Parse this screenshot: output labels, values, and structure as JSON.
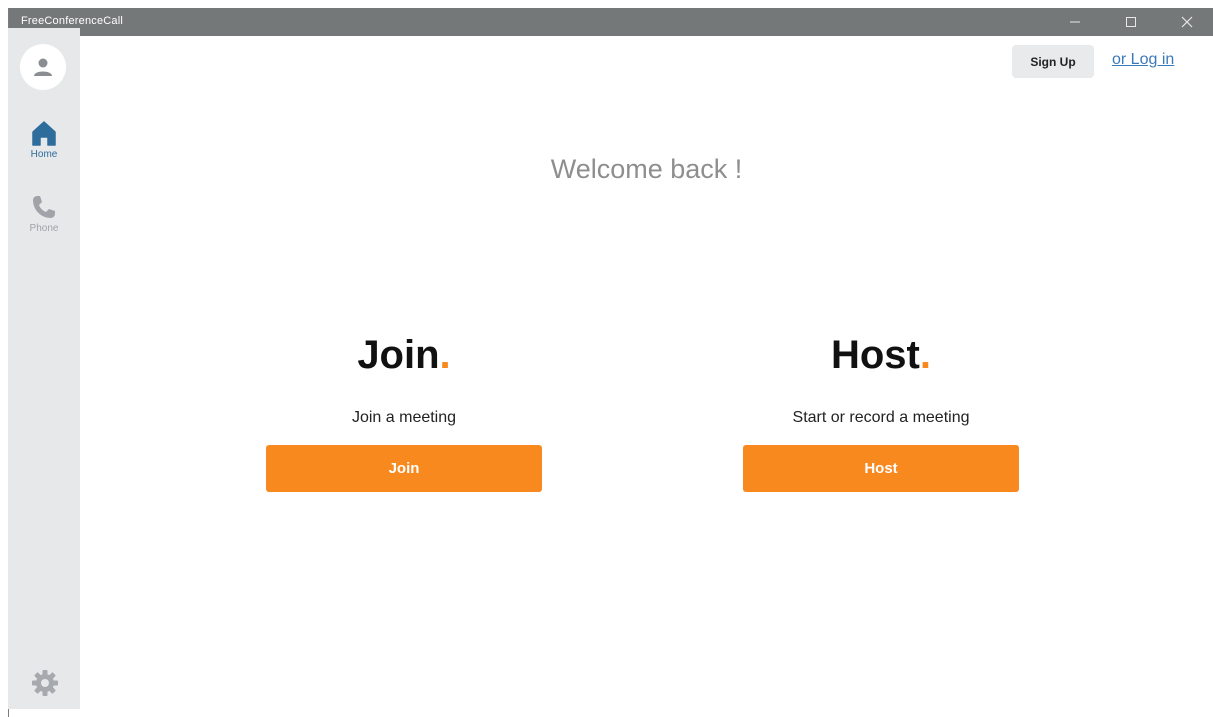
{
  "window": {
    "title": "FreeConferenceCall",
    "controls": [
      "minimize-icon",
      "maximize-icon",
      "close-icon"
    ]
  },
  "sidebar": {
    "avatar_icon": "user-icon",
    "items": [
      {
        "label": "Home",
        "icon": "home-icon",
        "active": true
      },
      {
        "label": "Phone",
        "icon": "phone-icon",
        "active": false
      }
    ],
    "settings_icon": "gear-icon"
  },
  "header": {
    "signup_label": "Sign Up",
    "login_label": "or Log in"
  },
  "main": {
    "welcome": "Welcome back !",
    "join": {
      "heading": "Join",
      "dot": ".",
      "subtitle": "Join a meeting",
      "button": "Join"
    },
    "host": {
      "heading": "Host",
      "dot": ".",
      "subtitle": "Start or record a meeting",
      "button": "Host"
    }
  },
  "colors": {
    "accent": "#f7891f",
    "titlebar": "#747879",
    "sidebar": "#e6e8ea",
    "active_nav": "#2e6c9c",
    "link": "#3b7ab8"
  }
}
